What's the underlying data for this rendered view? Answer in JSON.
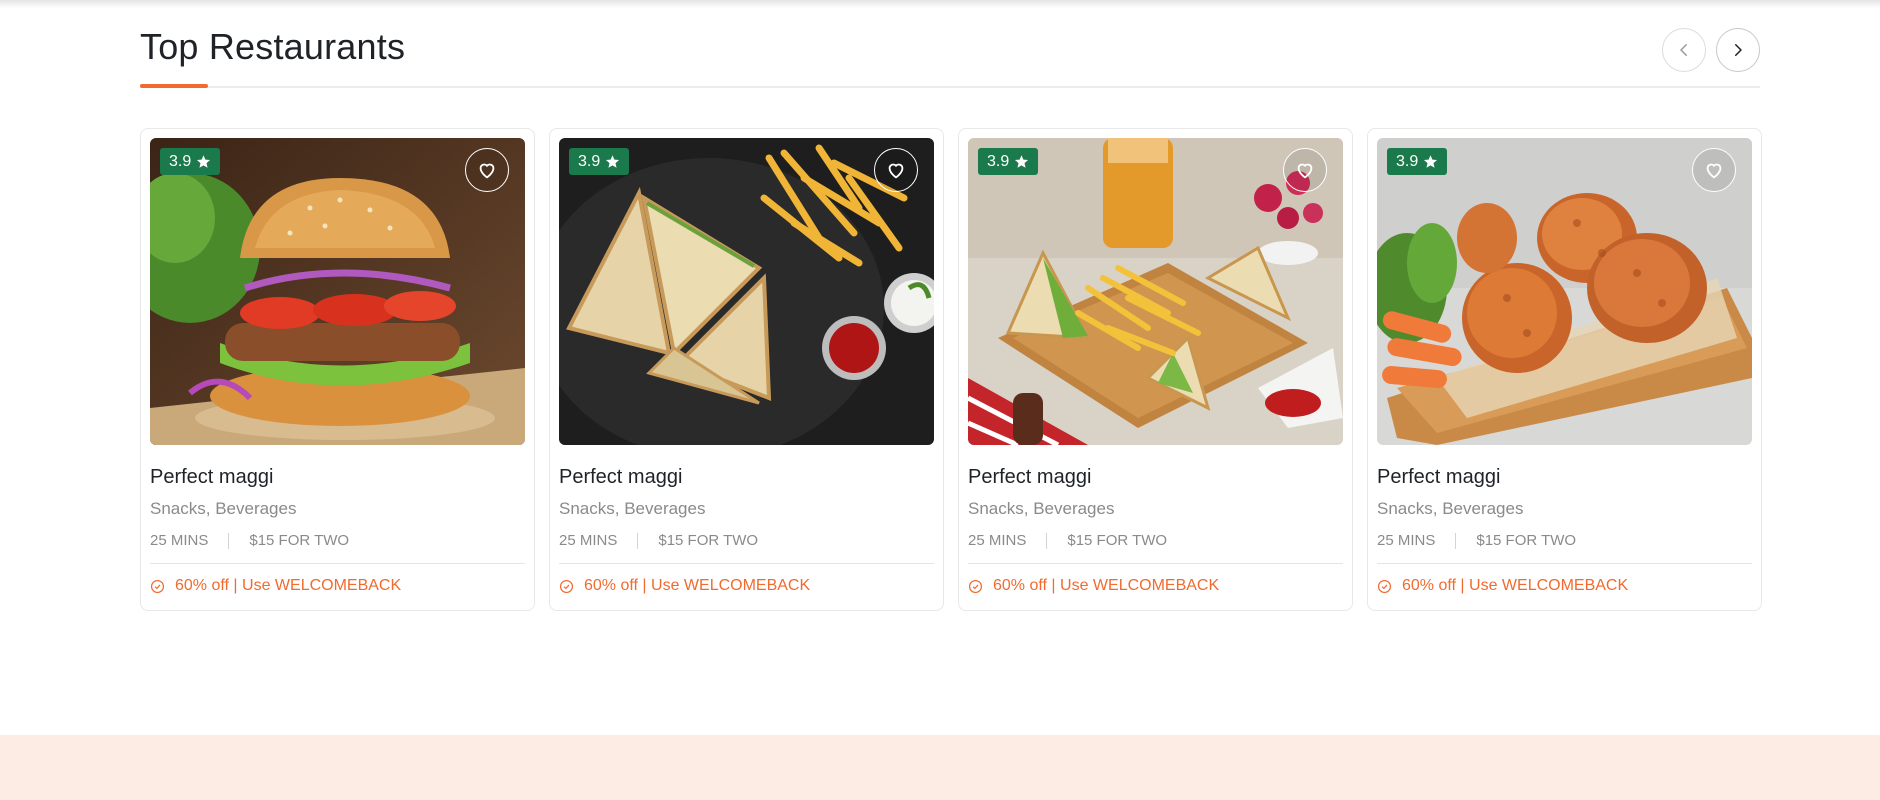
{
  "section": {
    "title": "Top Restaurants",
    "accent_color": "#f26a2e",
    "nav": {
      "prev_icon": "chevron-left-icon",
      "next_icon": "chevron-right-icon"
    }
  },
  "cards": [
    {
      "rating": "3.9",
      "name": "Perfect maggi",
      "cuisine": "Snacks, Beverages",
      "time": "25 MINS",
      "price": "$15 FOR TWO",
      "offer": "60% off | Use WELCOMEBACK",
      "image": "burger-photo"
    },
    {
      "rating": "3.9",
      "name": "Perfect maggi",
      "cuisine": "Snacks, Beverages",
      "time": "25 MINS",
      "price": "$15 FOR TWO",
      "offer": "60% off | Use WELCOMEBACK",
      "image": "sandwich-fries-photo"
    },
    {
      "rating": "3.9",
      "name": "Perfect maggi",
      "cuisine": "Snacks, Beverages",
      "time": "25 MINS",
      "price": "$15 FOR TWO",
      "offer": "60% off | Use WELCOMEBACK",
      "image": "club-sandwich-board-photo"
    },
    {
      "rating": "3.9",
      "name": "Perfect maggi",
      "cuisine": "Snacks, Beverages",
      "time": "25 MINS",
      "price": "$15 FOR TWO",
      "offer": "60% off | Use WELCOMEBACK",
      "image": "fried-chicken-photo"
    }
  ],
  "colors": {
    "rating_badge": "#1a7a4c",
    "offer_text": "#f26a2e",
    "footer_band": "#fdece4"
  }
}
